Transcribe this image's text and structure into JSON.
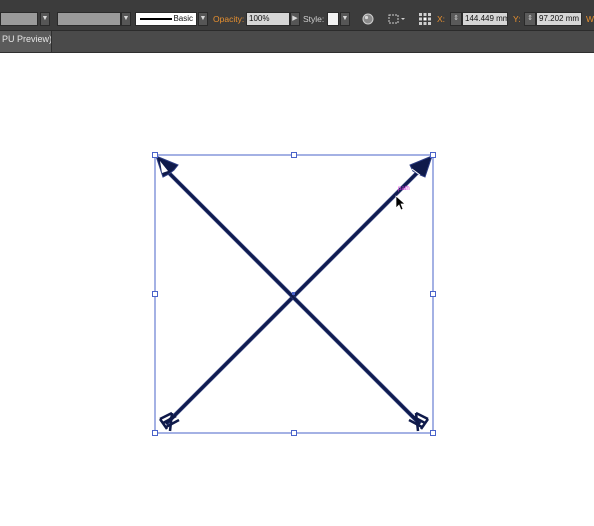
{
  "control_bar": {
    "stroke_profile_label": "Basic",
    "opacity_label": "Opacity:",
    "opacity_value": "100%",
    "style_label": "Style:",
    "x_label": "X:",
    "x_value": "144.449 mm",
    "y_label": "Y:",
    "y_value": "97.202 mm",
    "w_label": "W"
  },
  "tabs": [
    {
      "label": "PU Preview)"
    }
  ],
  "canvas": {
    "smart_guide_label": "path"
  },
  "colors": {
    "accent": "#e8902f",
    "arrow_stroke": "#0f1a4a",
    "selection": "#4a63c9",
    "smart_guide": "#e040e0"
  }
}
